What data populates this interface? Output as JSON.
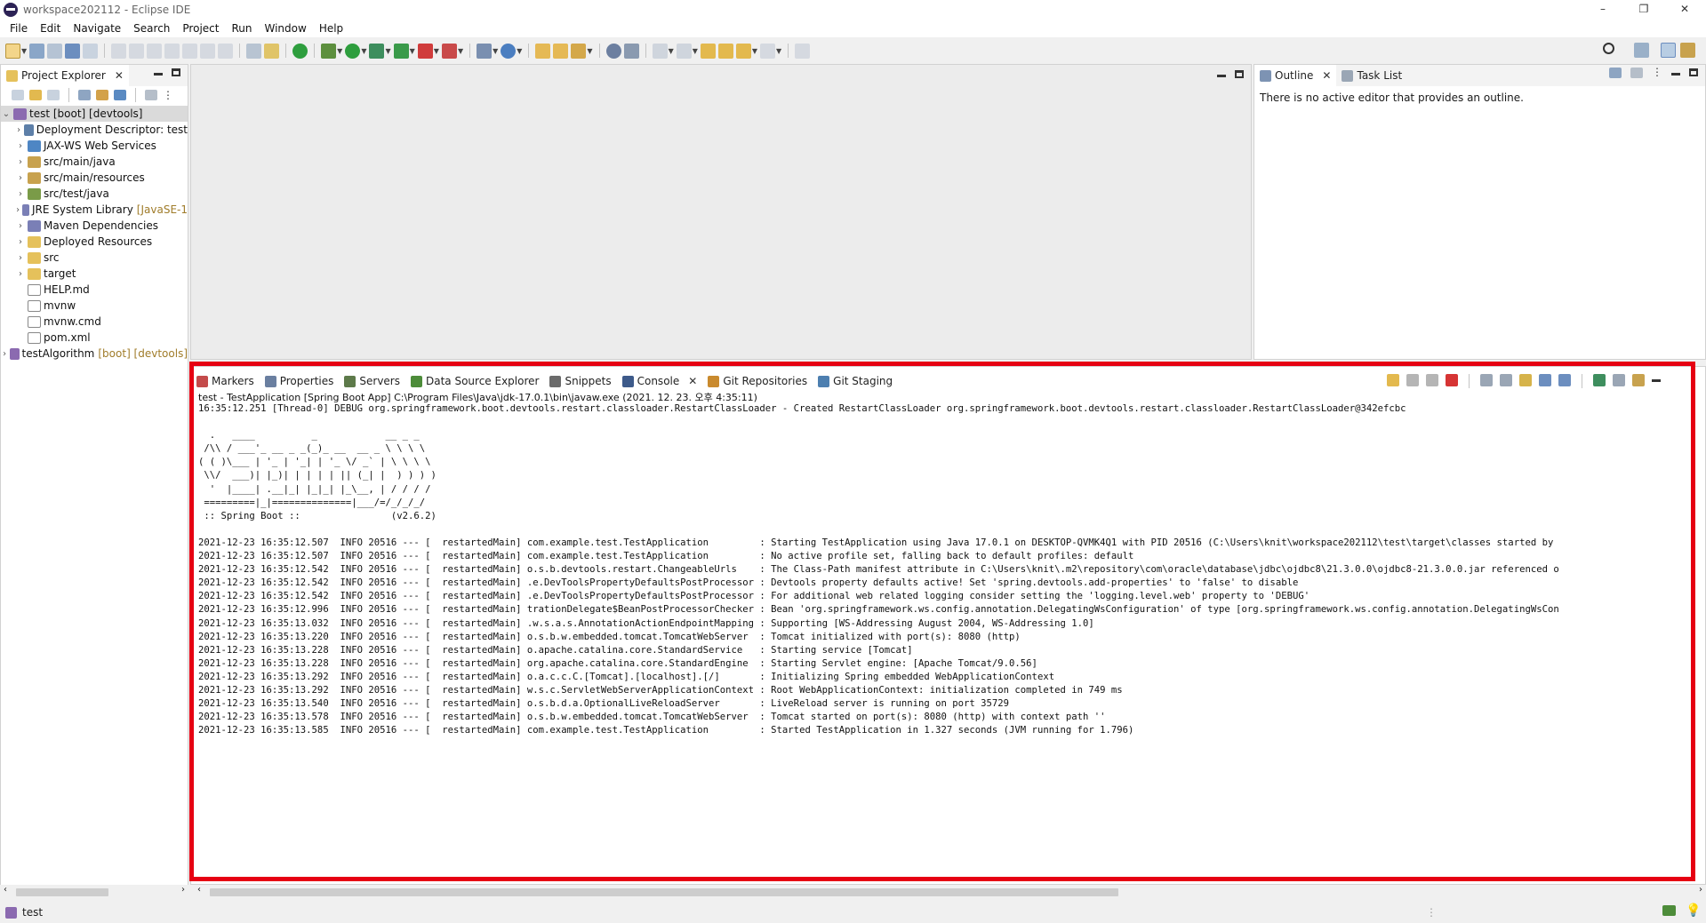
{
  "window": {
    "title": "workspace202112 - Eclipse IDE",
    "controls": [
      "–",
      "❐",
      "✕"
    ]
  },
  "menu": [
    "File",
    "Edit",
    "Navigate",
    "Search",
    "Project",
    "Run",
    "Window",
    "Help"
  ],
  "project_explorer": {
    "tab_label": "Project Explorer",
    "items": [
      {
        "label": "test [boot] [devtools]",
        "decoration": "",
        "level": 0,
        "expanded": true,
        "icon": "project-icon",
        "color": "#8b6ab0"
      },
      {
        "label": "Deployment Descriptor: test",
        "decoration": "",
        "level": 1,
        "icon": "deployment-descriptor-icon",
        "color": "#5d7fa8"
      },
      {
        "label": "JAX-WS Web Services",
        "decoration": "",
        "level": 1,
        "icon": "web-services-icon",
        "color": "#4e86c4"
      },
      {
        "label": "src/main/java",
        "decoration": "",
        "level": 1,
        "icon": "source-folder-icon",
        "color": "#c8a24e"
      },
      {
        "label": "src/main/resources",
        "decoration": "",
        "level": 1,
        "icon": "source-folder-icon",
        "color": "#c8a24e"
      },
      {
        "label": "src/test/java",
        "decoration": "",
        "level": 1,
        "icon": "source-folder-icon",
        "color": "#7a9b48"
      },
      {
        "label": "JRE System Library",
        "decoration": "[JavaSE-1",
        "level": 1,
        "icon": "library-icon",
        "color": "#7a7fb6"
      },
      {
        "label": "Maven Dependencies",
        "decoration": "",
        "level": 1,
        "icon": "library-icon",
        "color": "#7a7fb6"
      },
      {
        "label": "Deployed Resources",
        "decoration": "",
        "level": 1,
        "icon": "folder-icon",
        "color": "#e5c15b"
      },
      {
        "label": "src",
        "decoration": "",
        "level": 1,
        "icon": "folder-icon",
        "color": "#e5c15b"
      },
      {
        "label": "target",
        "decoration": "",
        "level": 1,
        "icon": "folder-icon",
        "color": "#e5c15b"
      },
      {
        "label": "HELP.md",
        "decoration": "",
        "level": 1,
        "leaf": true,
        "icon": "file-icon",
        "color": "#ffffff"
      },
      {
        "label": "mvnw",
        "decoration": "",
        "level": 1,
        "leaf": true,
        "icon": "file-icon",
        "color": "#ffffff"
      },
      {
        "label": "mvnw.cmd",
        "decoration": "",
        "level": 1,
        "leaf": true,
        "icon": "file-icon",
        "color": "#ffffff"
      },
      {
        "label": "pom.xml",
        "decoration": "",
        "level": 1,
        "leaf": true,
        "icon": "xml-file-icon",
        "color": "#ffffff"
      },
      {
        "label": "testAlgorithm",
        "decoration": "[boot] [devtools]",
        "level": 0,
        "expanded": false,
        "icon": "project-icon",
        "color": "#8b6ab0"
      }
    ]
  },
  "outline": {
    "tabs": [
      {
        "label": "Outline",
        "active": true
      },
      {
        "label": "Task List",
        "active": false
      }
    ],
    "message": "There is no active editor that provides an outline."
  },
  "bottom_tabs": [
    {
      "label": "Markers",
      "icon": "markers-icon",
      "color": "#c44b4b"
    },
    {
      "label": "Properties",
      "icon": "properties-icon",
      "color": "#6a7fa0"
    },
    {
      "label": "Servers",
      "icon": "servers-icon",
      "color": "#5d7a4a"
    },
    {
      "label": "Data Source Explorer",
      "icon": "data-source-icon",
      "color": "#4d8c3a"
    },
    {
      "label": "Snippets",
      "icon": "snippets-icon",
      "color": "#6b6b6b"
    },
    {
      "label": "Console",
      "icon": "console-icon",
      "color": "#3d5a8a",
      "active": true
    },
    {
      "label": "Git Repositories",
      "icon": "git-repositories-icon",
      "color": "#c98a2e"
    },
    {
      "label": "Git Staging",
      "icon": "git-staging-icon",
      "color": "#4d7fb0"
    }
  ],
  "console": {
    "header": "test - TestApplication [Spring Boot App] C:\\Program Files\\Java\\jdk-17.0.1\\bin\\javaw.exe  (2021. 12. 23. 오후 4:35:11)",
    "lines": [
      "16:35:12.251 [Thread-0] DEBUG org.springframework.boot.devtools.restart.classloader.RestartClassLoader - Created RestartClassLoader org.springframework.boot.devtools.restart.classloader.RestartClassLoader@342efcbc",
      "",
      "  .   ____          _            __ _ _",
      " /\\\\ / ___'_ __ _ _(_)_ __  __ _ \\ \\ \\ \\",
      "( ( )\\___ | '_ | '_| | '_ \\/ _` | \\ \\ \\ \\",
      " \\\\/  ___)| |_)| | | | | || (_| |  ) ) ) )",
      "  '  |____| .__|_| |_|_| |_\\__, | / / / /",
      " =========|_|==============|___/=/_/_/_/",
      " :: Spring Boot ::                (v2.6.2)",
      "",
      "2021-12-23 16:35:12.507  INFO 20516 --- [  restartedMain] com.example.test.TestApplication         : Starting TestApplication using Java 17.0.1 on DESKTOP-QVMK4Q1 with PID 20516 (C:\\Users\\knit\\workspace202112\\test\\target\\classes started by",
      "2021-12-23 16:35:12.507  INFO 20516 --- [  restartedMain] com.example.test.TestApplication         : No active profile set, falling back to default profiles: default",
      "2021-12-23 16:35:12.542  INFO 20516 --- [  restartedMain] o.s.b.devtools.restart.ChangeableUrls    : The Class-Path manifest attribute in C:\\Users\\knit\\.m2\\repository\\com\\oracle\\database\\jdbc\\ojdbc8\\21.3.0.0\\ojdbc8-21.3.0.0.jar referenced o",
      "2021-12-23 16:35:12.542  INFO 20516 --- [  restartedMain] .e.DevToolsPropertyDefaultsPostProcessor : Devtools property defaults active! Set 'spring.devtools.add-properties' to 'false' to disable",
      "2021-12-23 16:35:12.542  INFO 20516 --- [  restartedMain] .e.DevToolsPropertyDefaultsPostProcessor : For additional web related logging consider setting the 'logging.level.web' property to 'DEBUG'",
      "2021-12-23 16:35:12.996  INFO 20516 --- [  restartedMain] trationDelegate$BeanPostProcessorChecker : Bean 'org.springframework.ws.config.annotation.DelegatingWsConfiguration' of type [org.springframework.ws.config.annotation.DelegatingWsCon",
      "2021-12-23 16:35:13.032  INFO 20516 --- [  restartedMain] .w.s.a.s.AnnotationActionEndpointMapping : Supporting [WS-Addressing August 2004, WS-Addressing 1.0]",
      "2021-12-23 16:35:13.220  INFO 20516 --- [  restartedMain] o.s.b.w.embedded.tomcat.TomcatWebServer  : Tomcat initialized with port(s): 8080 (http)",
      "2021-12-23 16:35:13.228  INFO 20516 --- [  restartedMain] o.apache.catalina.core.StandardService   : Starting service [Tomcat]",
      "2021-12-23 16:35:13.228  INFO 20516 --- [  restartedMain] org.apache.catalina.core.StandardEngine  : Starting Servlet engine: [Apache Tomcat/9.0.56]",
      "2021-12-23 16:35:13.292  INFO 20516 --- [  restartedMain] o.a.c.c.C.[Tomcat].[localhost].[/]       : Initializing Spring embedded WebApplicationContext",
      "2021-12-23 16:35:13.292  INFO 20516 --- [  restartedMain] w.s.c.ServletWebServerApplicationContext : Root WebApplicationContext: initialization completed in 749 ms",
      "2021-12-23 16:35:13.540  INFO 20516 --- [  restartedMain] o.s.b.d.a.OptionalLiveReloadServer       : LiveReload server is running on port 35729",
      "2021-12-23 16:35:13.578  INFO 20516 --- [  restartedMain] o.s.b.w.embedded.tomcat.TomcatWebServer  : Tomcat started on port(s): 8080 (http) with context path ''",
      "2021-12-23 16:35:13.585  INFO 20516 --- [  restartedMain] com.example.test.TestApplication         : Started TestApplication in 1.327 seconds (JVM running for 1.796)"
    ]
  },
  "status": {
    "selection": "test"
  },
  "colors": {
    "highlight": "#e60012",
    "panel_border": "#d2d2d2",
    "tab_bg": "#f3f3f3"
  }
}
